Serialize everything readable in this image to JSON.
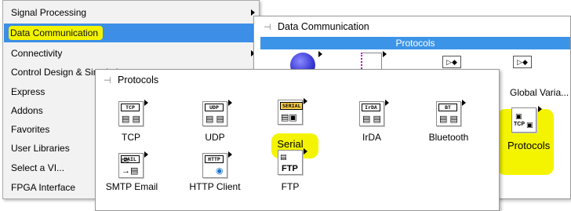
{
  "menu": {
    "items": [
      {
        "label": "Signal Processing",
        "selected": false
      },
      {
        "label": "Data Communication",
        "selected": true
      },
      {
        "label": "Connectivity",
        "selected": false
      },
      {
        "label": "Control Design & Simulation",
        "selected": false
      },
      {
        "label": "Express",
        "selected": false
      },
      {
        "label": "Addons",
        "selected": false
      },
      {
        "label": "Favorites",
        "selected": false
      },
      {
        "label": "User Libraries",
        "selected": false
      },
      {
        "label": "Select a VI...",
        "selected": false
      },
      {
        "label": "FPGA Interface",
        "selected": false
      }
    ]
  },
  "data_comm": {
    "title": "Data Communication",
    "section": "Protocols",
    "items": [
      {
        "label": "Global Varia...",
        "icon": "global-variable-icon"
      },
      {
        "label": "Protocols",
        "icon": "protocols-icon",
        "highlighted": true
      }
    ]
  },
  "protocols": {
    "title": "Protocols",
    "items": [
      {
        "label": "TCP",
        "tag": "TCP",
        "icon": "tcp-icon"
      },
      {
        "label": "UDP",
        "tag": "UDP",
        "icon": "udp-icon"
      },
      {
        "label": "Serial",
        "tag": "SERIAL",
        "icon": "serial-icon",
        "highlighted": true
      },
      {
        "label": "IrDA",
        "tag": "IrDA",
        "icon": "irda-icon"
      },
      {
        "label": "Bluetooth",
        "tag": "BT",
        "icon": "bluetooth-icon"
      },
      {
        "label": "SMTP Email",
        "tag": "MAIL",
        "icon": "smtp-email-icon"
      },
      {
        "label": "HTTP Client",
        "tag": "HTTP",
        "icon": "http-client-icon"
      },
      {
        "label": "FTP",
        "tag": "FTP",
        "icon": "ftp-icon"
      }
    ]
  },
  "colors": {
    "selection": "#3c8ee6",
    "highlighter": "#f4f400"
  }
}
